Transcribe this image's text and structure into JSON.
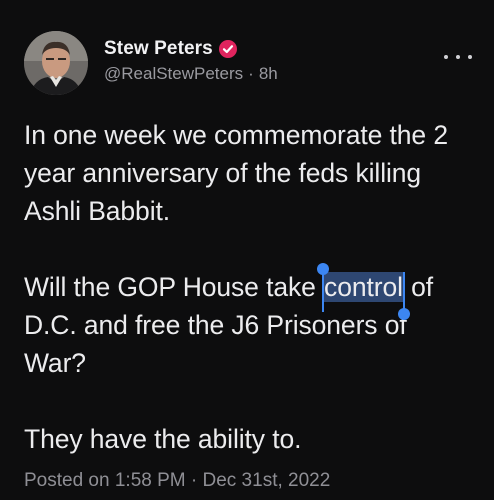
{
  "author": {
    "display_name": "Stew Peters",
    "handle": "@RealStewPeters",
    "separator": "·",
    "relative_time": "8h",
    "verified_badge_color": "#e0245e",
    "avatar_icon": "person-portrait"
  },
  "post": {
    "para1": "In one week we commemorate the 2 year anniversary of the feds killing Ashli Babbit.",
    "para2_before": "Will the GOP House take ",
    "para2_selected": "control",
    "para2_after": " of D.C. and free the J6 Prisoners of War?",
    "para3": "They have the ability to.",
    "selection_color": "#3c86f2"
  },
  "meta": {
    "posted": "Posted on 1:58 PM · Dec 31st, 2022"
  },
  "menu": {
    "icon": "more-horizontal-icon"
  }
}
